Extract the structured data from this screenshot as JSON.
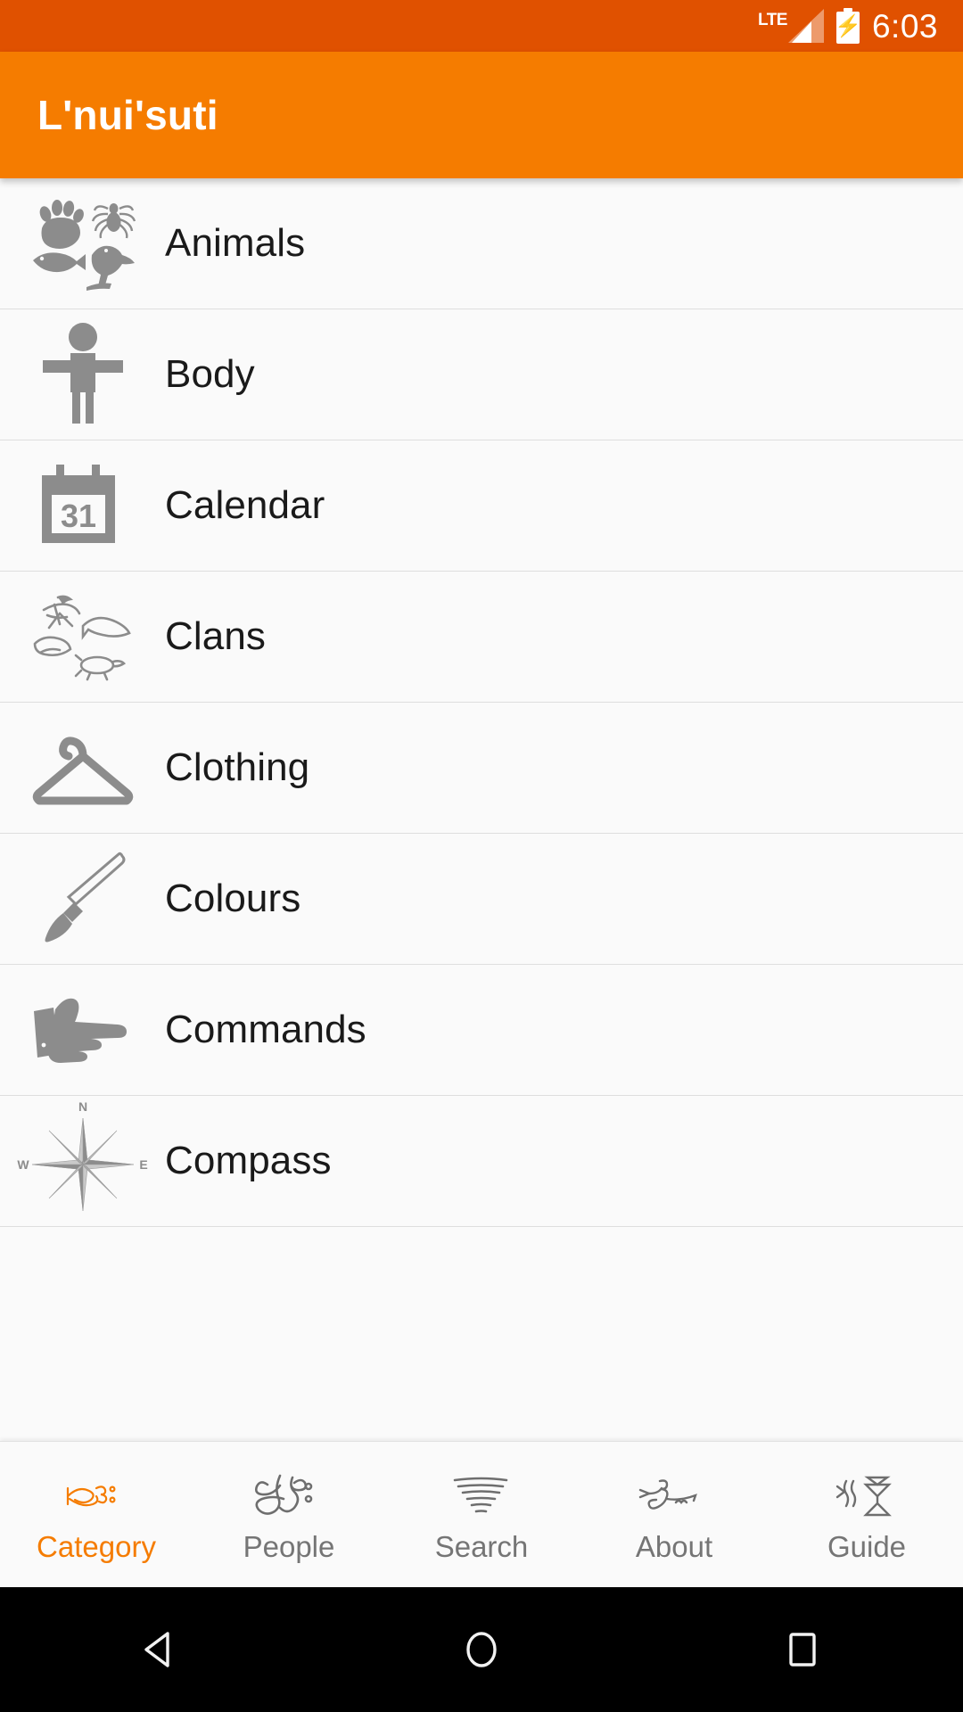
{
  "status_bar": {
    "network_label": "LTE",
    "battery_icon": "battery-charging-icon",
    "signal_icon": "signal-bars-icon",
    "time": "6:03",
    "background_color": "#E05100",
    "foreground_color": "#FFFFFF"
  },
  "app_bar": {
    "title": "L'nui'suti",
    "background_color": "#F57C00",
    "title_color": "#FFFFFF"
  },
  "categories": [
    {
      "label": "Animals",
      "icon": "animal-silhouettes-icon"
    },
    {
      "label": "Body",
      "icon": "human-figure-icon"
    },
    {
      "label": "Calendar",
      "icon": "calendar-31-icon"
    },
    {
      "label": "Clans",
      "icon": "clan-petroglyphs-icon"
    },
    {
      "label": "Clothing",
      "icon": "coat-hanger-icon"
    },
    {
      "label": "Colours",
      "icon": "paintbrush-icon"
    },
    {
      "label": "Commands",
      "icon": "pointing-hand-icon"
    },
    {
      "label": "Compass",
      "icon": "compass-rose-icon"
    }
  ],
  "compass_icon_labels": {
    "north": "N",
    "west": "W",
    "east": "E"
  },
  "calendar_icon_day": "31",
  "bottom_tabs": [
    {
      "label": "Category",
      "icon": "mikmaq-glyph-category-icon",
      "active": true
    },
    {
      "label": "People",
      "icon": "mikmaq-glyph-people-icon",
      "active": false
    },
    {
      "label": "Search",
      "icon": "mikmaq-glyph-search-icon",
      "active": false
    },
    {
      "label": "About",
      "icon": "mikmaq-glyph-about-icon",
      "active": false
    },
    {
      "label": "Guide",
      "icon": "mikmaq-glyph-guide-icon",
      "active": false
    }
  ],
  "tab_colors": {
    "active": "#F57C00",
    "inactive": "#757575"
  },
  "android_nav": {
    "back": "back-triangle-icon",
    "home": "home-circle-icon",
    "recents": "recents-square-icon",
    "background_color": "#000000"
  },
  "list_colors": {
    "background": "#FAFAFA",
    "divider": "#DEDEDE",
    "label": "#1A1A1A",
    "icon": "#8C8C8C"
  }
}
